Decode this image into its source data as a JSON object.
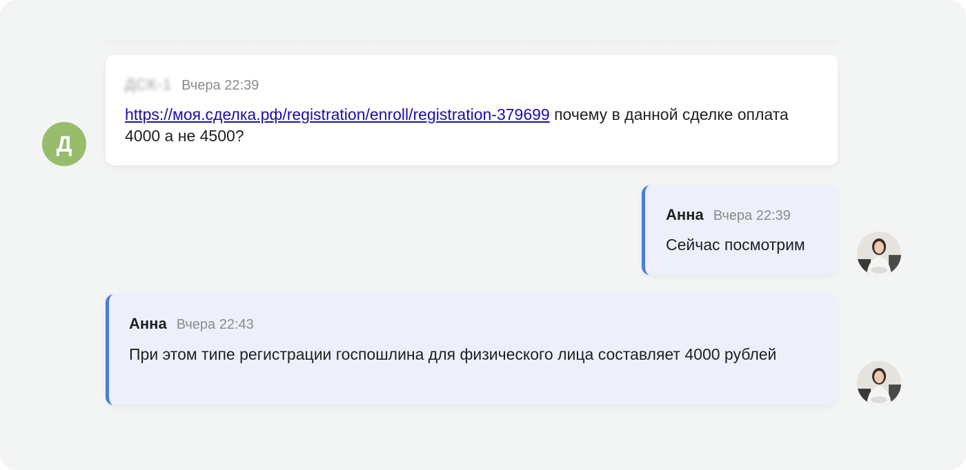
{
  "messages": [
    {
      "author": "ДСК-1",
      "time": "Вчера 22:39",
      "link": "https://моя.сделка.рф/registration/enroll/registration-379699",
      "text_after_link": " почему в данной сделке оплата 4000 а не 4500?",
      "avatar_letter": "Д"
    },
    {
      "author": "Анна",
      "time": "Вчера 22:39",
      "text": "Сейчас посмотрим"
    },
    {
      "author": "Анна",
      "time": "Вчера 22:43",
      "text": "При этом типе регистрации госпошлина для физического лица составляет 4000 рублей"
    }
  ],
  "colors": {
    "background": "#f3f4f4",
    "accent_border": "#4a7ddc",
    "operator_bubble": "#edf0fb",
    "client_avatar": "#97bd6c",
    "link": "#1a0dab"
  },
  "icons": [
    "user-avatar-letter",
    "operator-avatar-photo"
  ]
}
